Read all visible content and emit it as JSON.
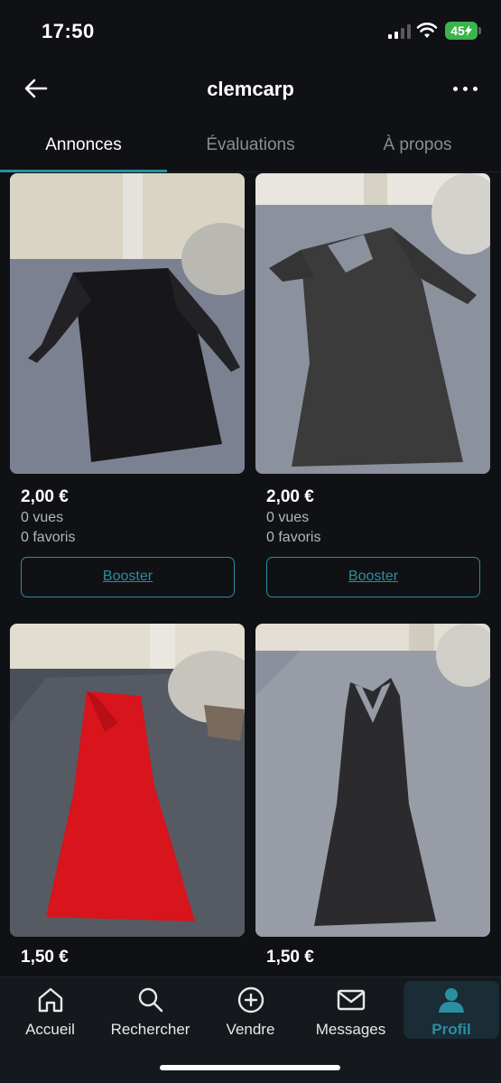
{
  "status_bar": {
    "time": "17:50",
    "battery": "45"
  },
  "header": {
    "title": "clemcarp"
  },
  "tabs": [
    {
      "label": "Annonces",
      "active": true
    },
    {
      "label": "Évaluations",
      "active": false
    },
    {
      "label": "À propos",
      "active": false
    }
  ],
  "listings": [
    {
      "price": "2,00 €",
      "views": "0 vues",
      "favorites": "0 favoris",
      "boost_label": "Booster",
      "photo": "black long-sleeve dress with lace-up sleeves on bed",
      "dress_color": "#141416"
    },
    {
      "price": "2,00 €",
      "views": "0 vues",
      "favorites": "0 favoris",
      "boost_label": "Booster",
      "photo": "dark grey half-sleeve fitted dress on bed",
      "dress_color": "#3a3a3a"
    },
    {
      "price": "1,50 €",
      "views": "",
      "favorites": "",
      "boost_label": "",
      "photo": "red sleeveless dress on bed",
      "dress_color": "#d8141c"
    },
    {
      "price": "1,50 €",
      "views": "",
      "favorites": "",
      "boost_label": "",
      "photo": "dark grey ribbed sleeveless maxi dress on bed",
      "dress_color": "#2c2c2c"
    }
  ],
  "bottom_nav": [
    {
      "label": "Accueil",
      "icon": "home-icon"
    },
    {
      "label": "Rechercher",
      "icon": "search-icon"
    },
    {
      "label": "Vendre",
      "icon": "plus-circle-icon"
    },
    {
      "label": "Messages",
      "icon": "envelope-icon"
    },
    {
      "label": "Profil",
      "icon": "profile-icon",
      "active": true
    }
  ],
  "colors": {
    "accent": "#2a8fa0",
    "background": "#101114",
    "battery": "#3bb54a"
  }
}
